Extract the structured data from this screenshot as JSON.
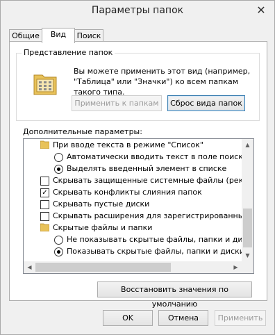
{
  "window": {
    "title": "Параметры папок",
    "close_glyph": "✕"
  },
  "tabs": [
    {
      "label": "Общие"
    },
    {
      "label": "Вид"
    },
    {
      "label": "Поиск"
    }
  ],
  "folder_view": {
    "group_label": "Представление папок",
    "description": "Вы можете применить этот вид (например, \"Таблица\" или \"Значки\") ко всем папкам такого типа.",
    "apply_button": "Применить к папкам",
    "reset_button": "Сброс вида папок"
  },
  "advanced": {
    "label": "Дополнительные параметры:",
    "items": [
      {
        "type": "folder",
        "text": "При вводе текста в режиме \"Список\""
      },
      {
        "type": "radio",
        "checked": false,
        "text": "Автоматически вводить текст в поле поиска"
      },
      {
        "type": "radio",
        "checked": true,
        "text": "Выделять введенный элемент в списке"
      },
      {
        "type": "checkbox",
        "checked": false,
        "text": "Скрывать защищенные системные файлы (рекомен"
      },
      {
        "type": "checkbox",
        "checked": true,
        "text": "Скрывать конфликты слияния папок"
      },
      {
        "type": "checkbox",
        "checked": false,
        "text": "Скрывать пустые диски"
      },
      {
        "type": "checkbox",
        "checked": false,
        "text": "Скрывать расширения для зарегистрированных типо"
      },
      {
        "type": "folder",
        "text": "Скрытые файлы и папки"
      },
      {
        "type": "radio",
        "checked": false,
        "text": "Не показывать скрытые файлы, папки и диски"
      },
      {
        "type": "radio",
        "checked": true,
        "text": "Показывать скрытые файлы, папки и диски"
      }
    ],
    "restore_button": "Восстановить значения по умолчанию"
  },
  "footer": {
    "ok": "OK",
    "cancel": "Отмена",
    "apply": "Применить"
  },
  "colors": {
    "accent": "#3c7fb1",
    "folder": "#e8c25a"
  }
}
